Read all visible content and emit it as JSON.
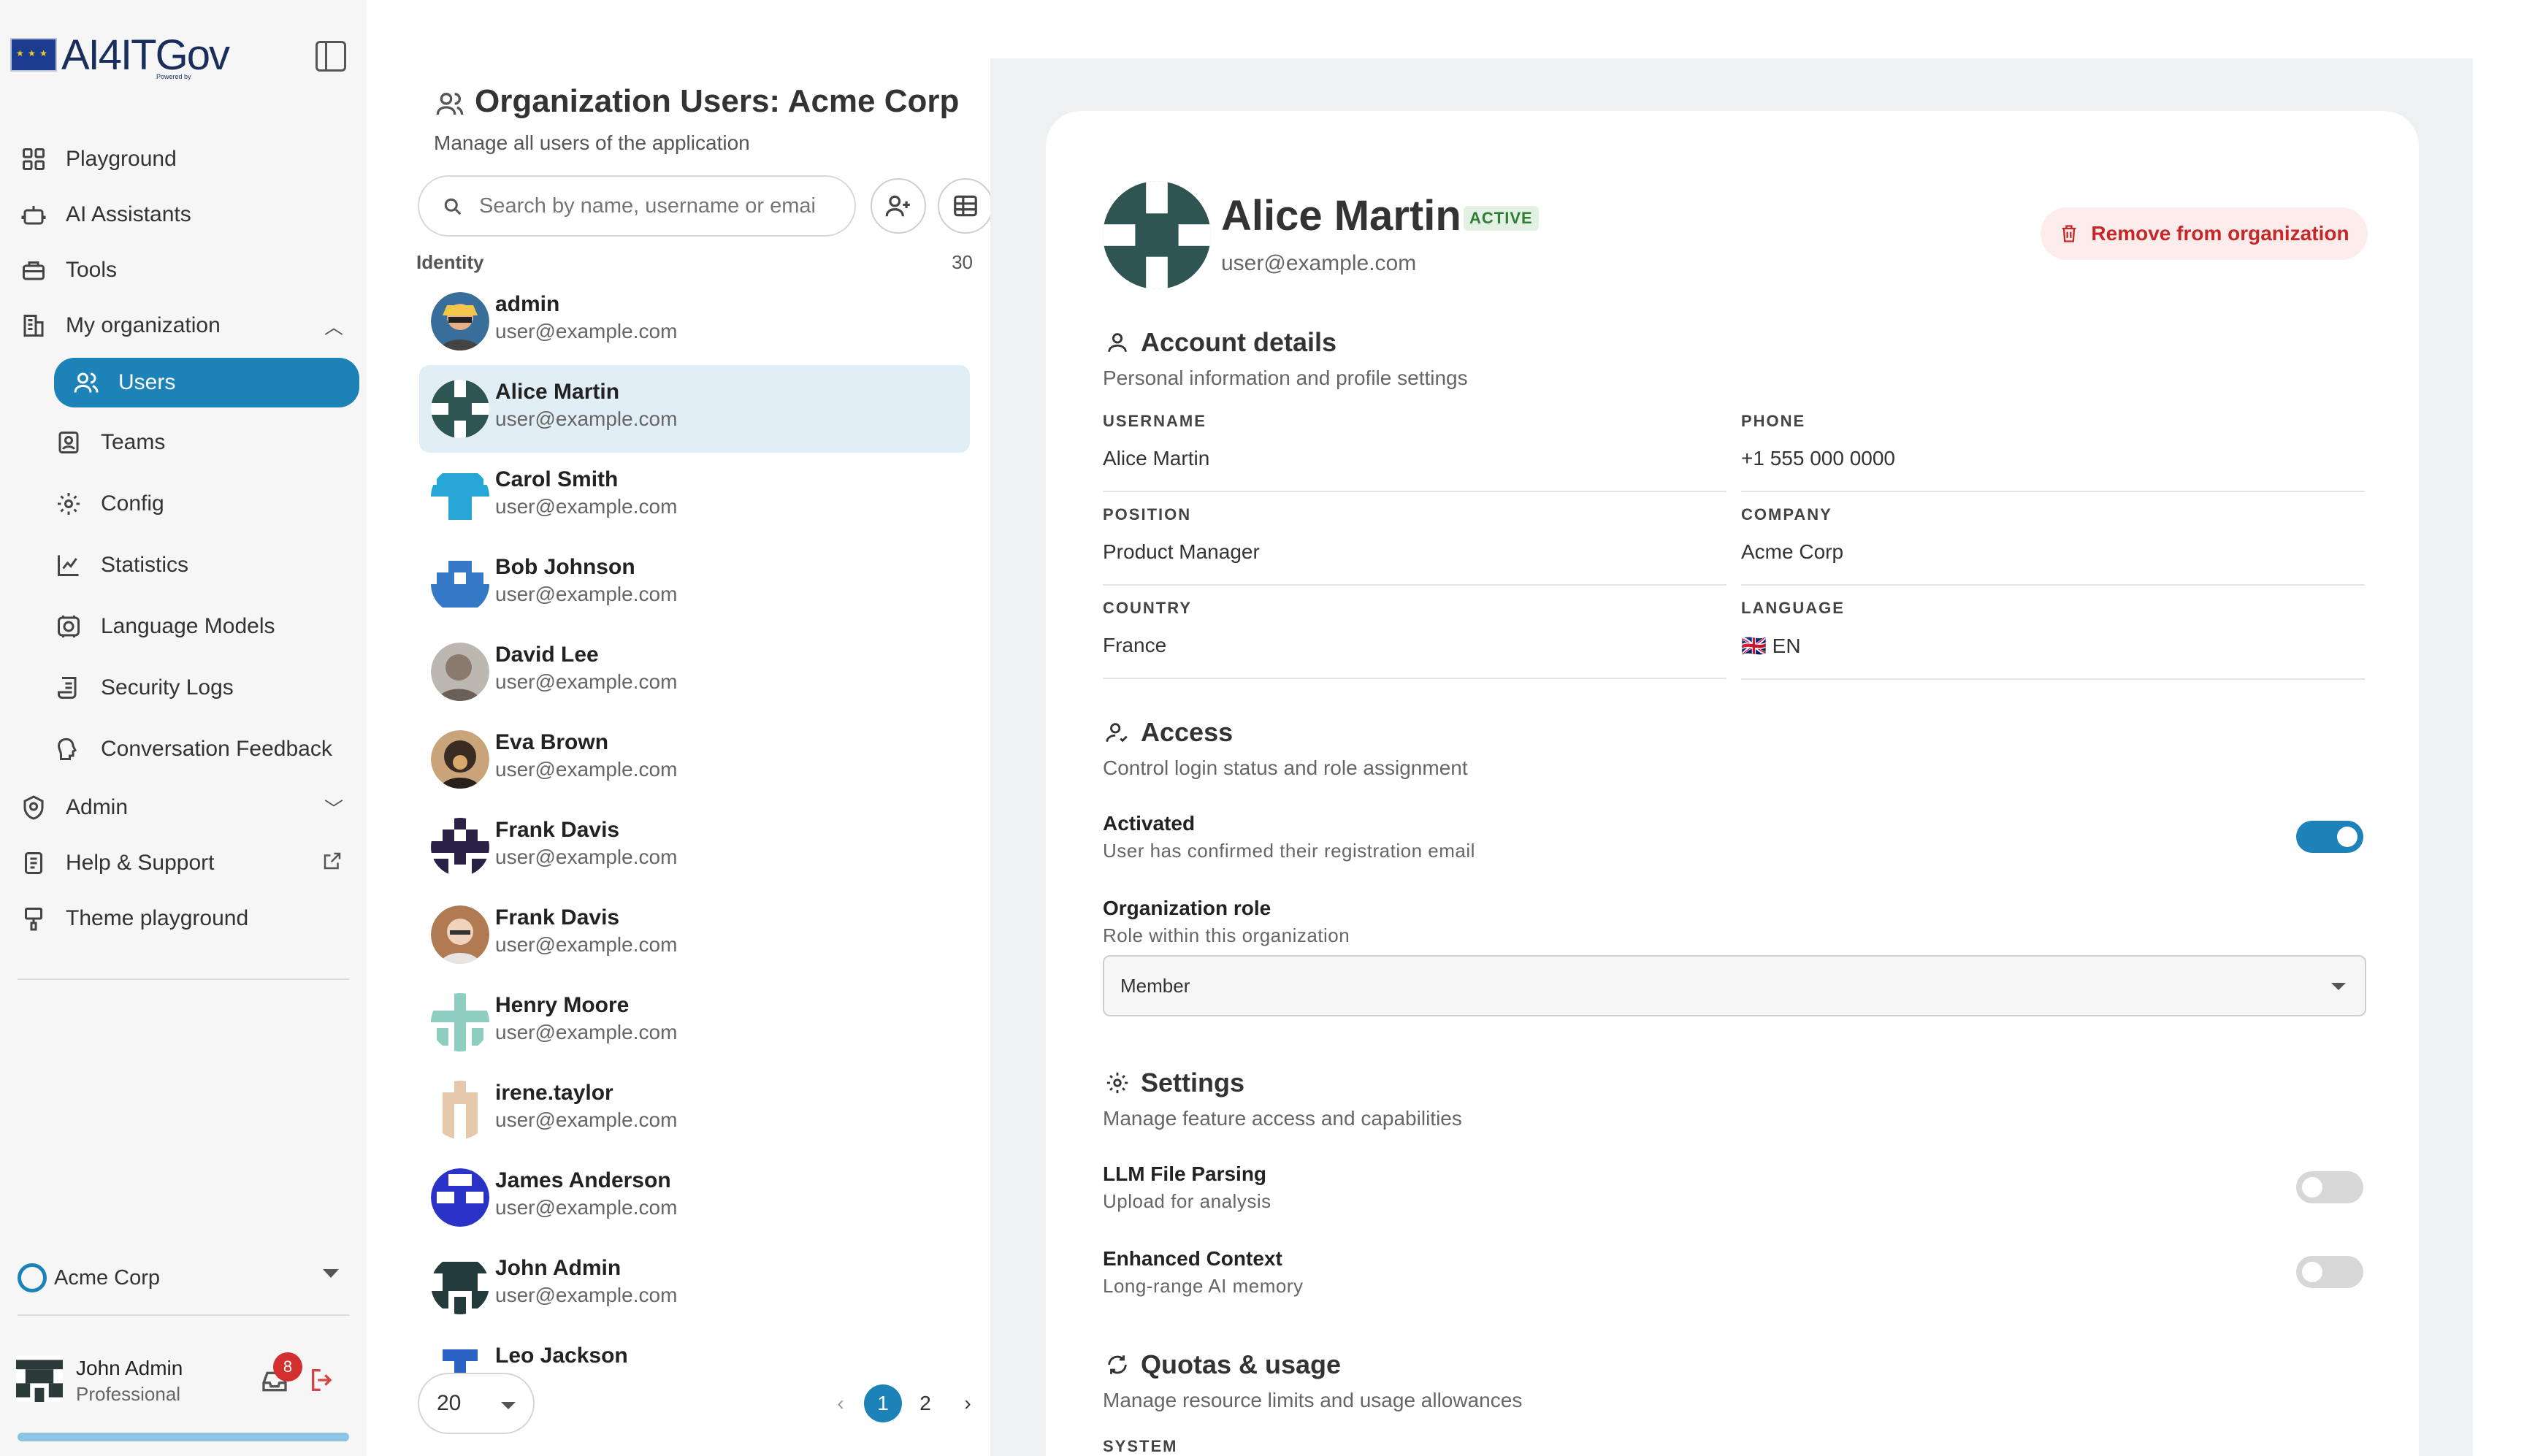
{
  "app": {
    "logo_text": "AI4ITGov",
    "logo_sub": "Powered by"
  },
  "sidebar": {
    "items": [
      {
        "label": "Playground",
        "icon": "grid-icon"
      },
      {
        "label": "AI Assistants",
        "icon": "robot-icon"
      },
      {
        "label": "Tools",
        "icon": "toolbox-icon"
      },
      {
        "label": "My organization",
        "icon": "building-icon"
      }
    ],
    "sub_items": [
      {
        "label": "Users",
        "icon": "users-icon",
        "active": true
      },
      {
        "label": "Teams",
        "icon": "id-card-icon"
      },
      {
        "label": "Config",
        "icon": "gear-icon"
      },
      {
        "label": "Statistics",
        "icon": "chart-icon"
      },
      {
        "label": "Language Models",
        "icon": "brain-icon"
      },
      {
        "label": "Security Logs",
        "icon": "scroll-icon"
      },
      {
        "label": "Conversation Feedback",
        "icon": "feedback-icon"
      }
    ],
    "lower_items": [
      {
        "label": "Admin",
        "icon": "shield-icon"
      },
      {
        "label": "Help & Support",
        "icon": "document-icon"
      },
      {
        "label": "Theme playground",
        "icon": "brush-icon"
      }
    ],
    "org_switch": "Acme Corp",
    "current_user": {
      "name": "John Admin",
      "plan": "Professional",
      "notifications": "8"
    },
    "usage_progress": 1.0
  },
  "list": {
    "title": "Organization Users: Acme Corp",
    "subtitle": "Manage all users of the application",
    "search_placeholder": "Search by name, username or emai",
    "column_identity": "Identity",
    "count": "30",
    "users": [
      {
        "name": "admin",
        "email": "user@example.com"
      },
      {
        "name": "Alice Martin",
        "email": "user@example.com"
      },
      {
        "name": "Carol Smith",
        "email": "user@example.com"
      },
      {
        "name": "Bob Johnson",
        "email": "user@example.com"
      },
      {
        "name": "David Lee",
        "email": "user@example.com"
      },
      {
        "name": "Eva Brown",
        "email": "user@example.com"
      },
      {
        "name": "Frank Davis",
        "email": "user@example.com"
      },
      {
        "name": "Frank Davis",
        "email": "user@example.com"
      },
      {
        "name": "Henry Moore",
        "email": "user@example.com"
      },
      {
        "name": "irene.taylor",
        "email": "user@example.com"
      },
      {
        "name": "James Anderson",
        "email": "user@example.com"
      },
      {
        "name": "John Admin",
        "email": "user@example.com"
      },
      {
        "name": "Leo Jackson",
        "email": ""
      }
    ],
    "page_size": "20",
    "pages": [
      "1",
      "2"
    ],
    "prev": "‹",
    "next": "›"
  },
  "detail": {
    "name": "Alice Martin",
    "status": "ACTIVE",
    "email": "user@example.com",
    "remove_label": "Remove from organization",
    "account": {
      "title": "Account details",
      "subtitle": "Personal information and profile settings",
      "fields": {
        "username_label": "USERNAME",
        "username": "Alice Martin",
        "phone_label": "PHONE",
        "phone": "+1 555 000 0000",
        "position_label": "POSITION",
        "position": "Product Manager",
        "company_label": "COMPANY",
        "company": "Acme Corp",
        "country_label": "COUNTRY",
        "country": "France",
        "language_label": "LANGUAGE",
        "language": "🇬🇧 EN"
      }
    },
    "access": {
      "title": "Access",
      "subtitle": "Control login status and role assignment",
      "activated_title": "Activated",
      "activated_sub": "User has confirmed their registration email",
      "activated": true,
      "role_title": "Organization role",
      "role_sub": "Role within this organization",
      "role_value": "Member"
    },
    "settings": {
      "title": "Settings",
      "subtitle": "Manage feature access and capabilities",
      "llm_title": "LLM File Parsing",
      "llm_sub": "Upload for analysis",
      "llm_on": false,
      "ctx_title": "Enhanced Context",
      "ctx_sub": "Long-range AI memory",
      "ctx_on": false
    },
    "quotas": {
      "title": "Quotas & usage",
      "subtitle": "Manage resource limits and usage allowances",
      "system_label": "SYSTEM"
    }
  },
  "colors": {
    "accent": "#1c82b8",
    "selected_row": "#e2eef6",
    "danger": "#c62828",
    "success": "#2e7d32"
  }
}
